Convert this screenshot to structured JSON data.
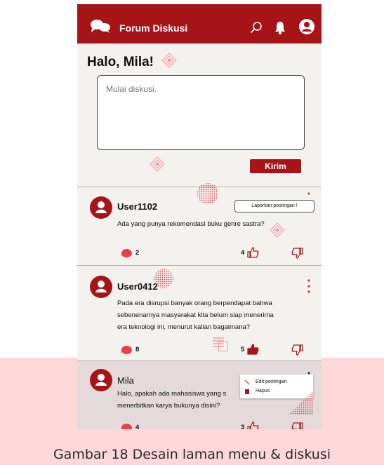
{
  "app_bar": {
    "title": "Forum Diskusi"
  },
  "greeting": "Halo, Mila!",
  "compose": {
    "placeholder": "Mulai diskusi.",
    "send_label": "Kirim"
  },
  "posts": [
    {
      "username": "User1102",
      "lines": [
        "Ada yang punya rekomendasi buku genre sastra?"
      ],
      "comments": "2",
      "likes": "4",
      "report_label": "Laporkan postingan !"
    },
    {
      "username": "User0412",
      "lines": [
        "Pada era disrupsi banyak orang berpendapat bahwa",
        "sebenenarnya masyarakat kita belum siap menerima",
        "era teknologi ini, menurut kalian bagaimana?"
      ],
      "comments": "8",
      "likes": "5"
    },
    {
      "username": "Mila",
      "lines": [
        "Halo, apakah ada mahasiswa yang s",
        "menerbitkan karya bukunya disini?"
      ],
      "comments": "4",
      "likes": "3",
      "menu": [
        {
          "label": "Edit postingan",
          "icon": "pencil-icon"
        },
        {
          "label": "Hapus",
          "icon": "trash-icon"
        }
      ]
    }
  ],
  "caption": "Gambar 18 Desain laman menu & diskusi",
  "colors": {
    "brand": "#a61418",
    "accent": "#e8404a",
    "background": "#f4f2ef",
    "caption_band": "#fcd8d9"
  }
}
